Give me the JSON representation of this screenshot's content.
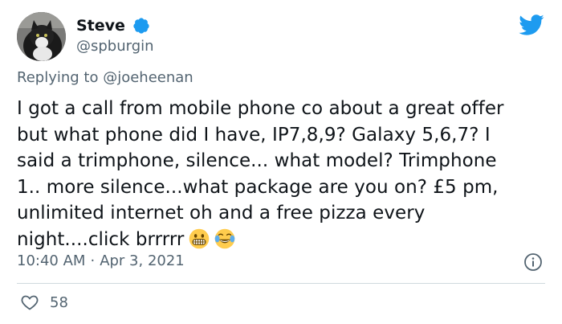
{
  "author": {
    "name": "Steve",
    "handle": "@spburgin",
    "verified": true
  },
  "reply": {
    "prefix": "Replying to",
    "mention": "@joeheenan"
  },
  "tweet": {
    "text": "I got a call from mobile phone co about a great offer\nbut what phone did I have, IP7,8,9? Galaxy 5,6,7? I\nsaid a trimphone, silence... what model? Trimphone\n1.. more silence...what package are you on? £5 pm,\nunlimited internet oh and a free pizza every\nnight....click brrrrr",
    "emojis": [
      "grimacing-face",
      "face-with-tears-of-joy"
    ]
  },
  "meta": {
    "time": "10:40 AM",
    "separator": "·",
    "date": "Apr 3, 2021"
  },
  "engagement": {
    "likes": "58"
  },
  "colors": {
    "brand": "#1d9bf0",
    "secondary_text": "#536471",
    "primary_text": "#0f1419",
    "divider": "#cfd9de"
  },
  "icons": [
    "avatar-cat",
    "verified-badge-icon",
    "twitter-bird-icon",
    "info-icon",
    "heart-icon"
  ]
}
